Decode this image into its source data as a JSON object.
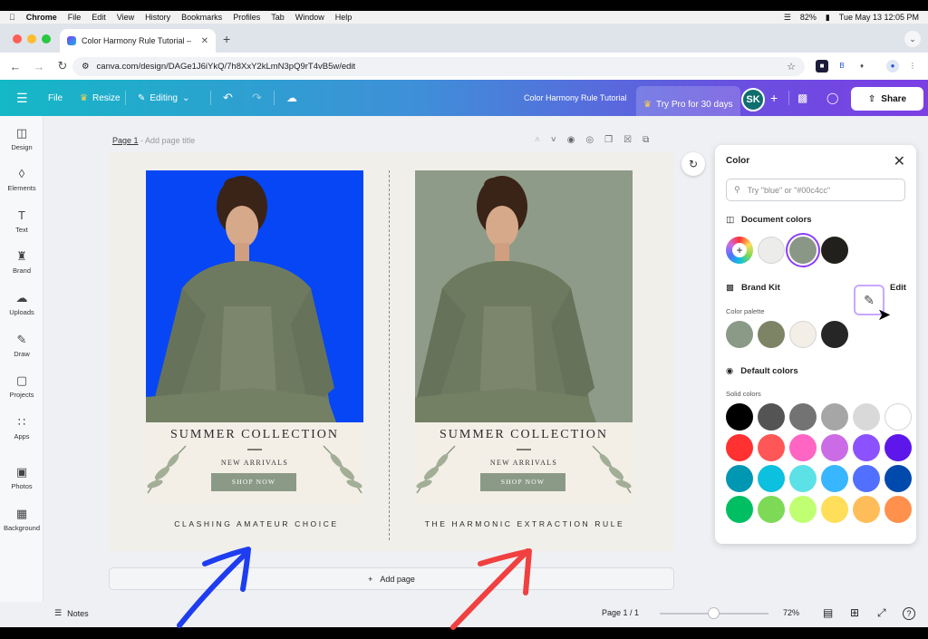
{
  "macos": {
    "app": "Chrome",
    "menus": [
      "File",
      "Edit",
      "View",
      "History",
      "Bookmarks",
      "Profiles",
      "Tab",
      "Window",
      "Help"
    ],
    "battery": "82%",
    "datetime": "Tue May 13  12:05 PM"
  },
  "browser": {
    "tab_title": "Color Harmony Rule Tutorial – ",
    "url": "canva.com/design/DAGe1J6iYkQ/7h8XxY2kLmN3pQ9rT4vB5w/edit"
  },
  "topbar": {
    "file": "File",
    "resize": "Resize",
    "editing": "Editing",
    "doc_title": "Color Harmony Rule Tutorial",
    "try_pro": "Try Pro for 30 days",
    "avatar": "SK",
    "share": "Share"
  },
  "sidebar": {
    "items": [
      {
        "label": "Design",
        "icon": "design-icon"
      },
      {
        "label": "Elements",
        "icon": "elements-icon"
      },
      {
        "label": "Text",
        "icon": "text-icon"
      },
      {
        "label": "Brand",
        "icon": "brand-icon"
      },
      {
        "label": "Uploads",
        "icon": "uploads-icon"
      },
      {
        "label": "Draw",
        "icon": "draw-icon"
      },
      {
        "label": "Projects",
        "icon": "projects-icon"
      },
      {
        "label": "Apps",
        "icon": "apps-icon"
      },
      {
        "label": "Photos",
        "icon": "photos-icon"
      },
      {
        "label": "Background",
        "icon": "background-icon"
      }
    ]
  },
  "page": {
    "label": "Page 1",
    "title_placeholder": "- Add page title"
  },
  "designs": [
    {
      "title": "SUMMER COLLECTION",
      "subtitle": "NEW ARRIVALS",
      "button": "SHOP NOW",
      "caption": "CLASHING AMATEUR CHOICE",
      "background": "#0646f5"
    },
    {
      "title": "SUMMER COLLECTION",
      "subtitle": "NEW ARRIVALS",
      "button": "SHOP NOW",
      "caption": "THE HARMONIC EXTRACTION RULE",
      "background": "#8e9b88"
    }
  ],
  "add_page": "Add page",
  "color_panel": {
    "title": "Color",
    "search_placeholder": "Try \"blue\" or \"#00c4cc\"",
    "document_colors_label": "Document colors",
    "document_colors": [
      "#ececea",
      "#8a9787",
      "#22201c"
    ],
    "brand_kit_label": "Brand Kit",
    "edit_label": "Edit",
    "palette_label": "Color palette",
    "palette": [
      "#8a9a86",
      "#7d8466",
      "#f3efe6",
      "#262626"
    ],
    "default_colors_label": "Default colors",
    "solid_label": "Solid colors",
    "solid_colors": [
      "#000000",
      "#545454",
      "#737373",
      "#a6a6a6",
      "#d9d9d9",
      "#ffffff",
      "#ff3131",
      "#ff5757",
      "#ff66c4",
      "#cb6ce6",
      "#8c52ff",
      "#5e17eb",
      "#0097b2",
      "#0cc0df",
      "#5ce1e6",
      "#38b6ff",
      "#5170ff",
      "#004aad",
      "#00bf63",
      "#7ed957",
      "#c1ff72",
      "#ffde59",
      "#ffbd59",
      "#ff914d"
    ]
  },
  "bottombar": {
    "notes": "Notes",
    "page_indicator": "Page 1 / 1",
    "zoom": "72%"
  }
}
